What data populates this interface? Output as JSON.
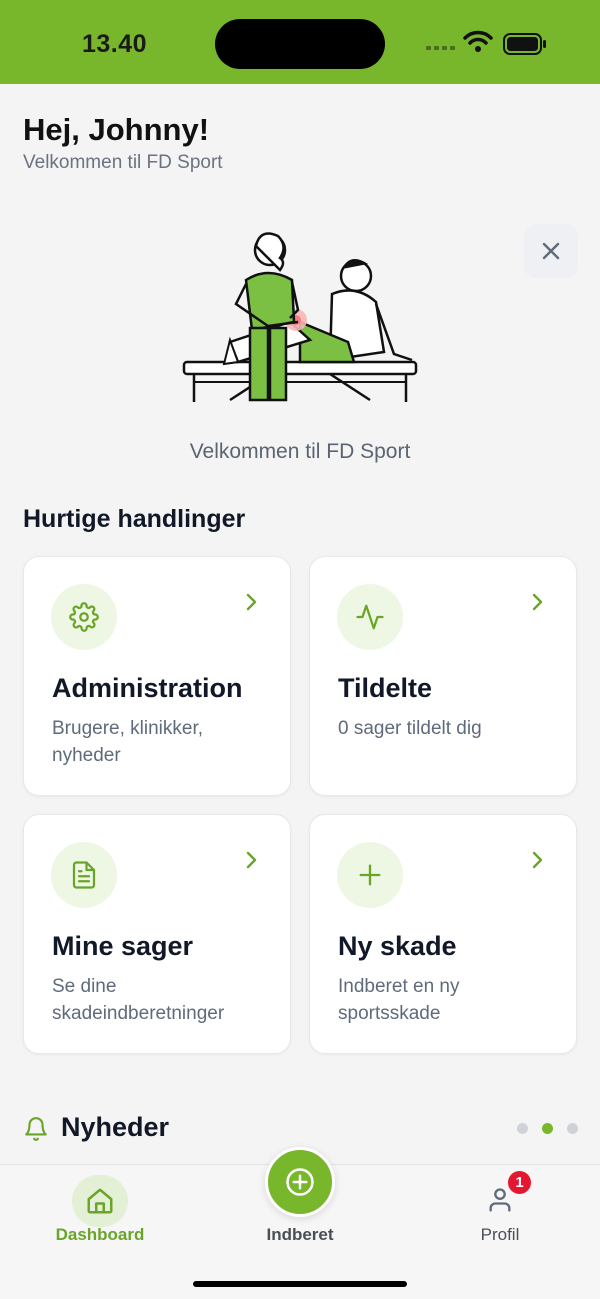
{
  "status_bar": {
    "time": "13.40"
  },
  "header": {
    "greeting": "Hej, Johnny!",
    "subtitle": "Velkommen til FD Sport"
  },
  "welcome_banner": {
    "text": "Velkommen til FD Sport"
  },
  "quick_actions": {
    "title": "Hurtige handlinger",
    "cards": [
      {
        "title": "Administration",
        "desc": "Brugere, klinikker, nyheder",
        "icon": "gear-icon"
      },
      {
        "title": "Tildelte",
        "desc": "0 sager tildelt dig",
        "icon": "activity-icon"
      },
      {
        "title": "Mine sager",
        "desc": "Se dine skadeindberetninger",
        "icon": "document-icon"
      },
      {
        "title": "Ny skade",
        "desc": "Indberet en ny sportsskade",
        "icon": "plus-icon"
      }
    ]
  },
  "news": {
    "title": "Nyheder",
    "pages": 3,
    "active_page": 2
  },
  "tab_bar": {
    "items": [
      {
        "label": "Dashboard",
        "icon": "home-icon",
        "active": true
      },
      {
        "label": "Indberet",
        "icon": "plus-circle-icon",
        "active": false
      },
      {
        "label": "Profil",
        "icon": "user-icon",
        "active": false,
        "badge": "1"
      }
    ]
  },
  "colors": {
    "accent": "#78b62b",
    "accent_light": "#eef7e4",
    "badge": "#e5162f",
    "text_primary": "#111827",
    "text_secondary": "#5f6b7a"
  }
}
